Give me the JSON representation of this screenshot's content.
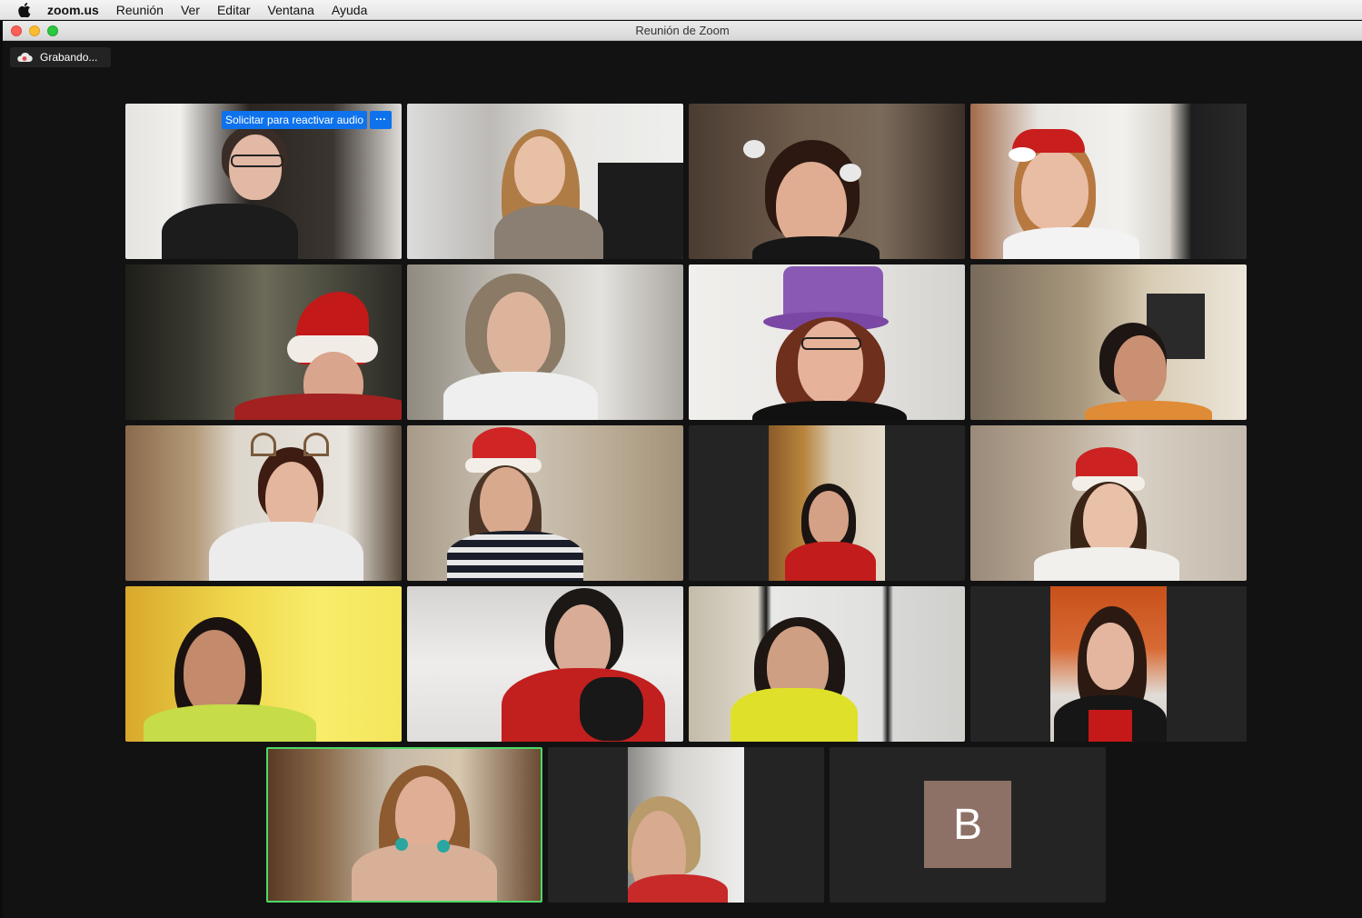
{
  "menubar": {
    "app": "zoom.us",
    "items": [
      "Reunión",
      "Ver",
      "Editar",
      "Ventana",
      "Ayuda"
    ]
  },
  "window": {
    "title": "Reunión de Zoom"
  },
  "recording": {
    "label": "Grabando...",
    "icon": "cloud-record-icon"
  },
  "mute_banner": {
    "label": "Solicitar para reactivar audio",
    "more": "···"
  },
  "avatar": {
    "initial": "B",
    "color": "#8d7167"
  },
  "colors": {
    "active_speaker_border": "#4cd964",
    "accent_blue": "#0e72ed"
  }
}
